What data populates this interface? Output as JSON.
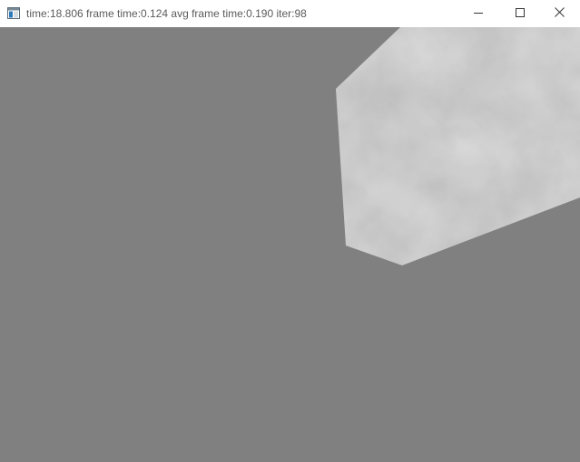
{
  "window": {
    "title": "time:18.806 frame time:0.124 avg frame time:0.190 iter:98",
    "icons": {
      "app": "app-window-icon",
      "minimize": "minimize-icon",
      "maximize": "maximize-icon",
      "close": "close-icon"
    }
  },
  "colors": {
    "titlebar_bg": "#ffffff",
    "title_text": "#5b5b5b",
    "viewport_bg": "#808080",
    "shape_fill": "#959595"
  }
}
